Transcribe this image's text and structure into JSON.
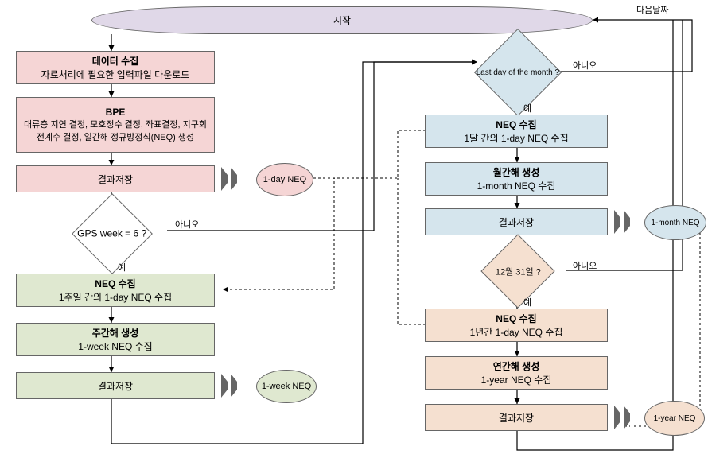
{
  "start": "시작",
  "nextDate": "다음날짜",
  "yes": "예",
  "no": "아니오",
  "left": {
    "dataCollect": {
      "t": "데이터 수집",
      "s": "자료처리에 필요한 입력파일 다운로드"
    },
    "bpe": {
      "t": "BPE",
      "s": "대류층 지연 결정, 모호정수 결정, 좌표결정, 지구회전계수 결정, 일간해 정규방정식(NEQ) 생성"
    },
    "save1": "결과저장",
    "neq1": "1-day NEQ",
    "d1": "GPS week = 6 ?",
    "neqC": {
      "t": "NEQ 수집",
      "s": "1주일 간의 1-day NEQ 수집"
    },
    "wk": {
      "t": "주간해 생성",
      "s": "1-week NEQ 수집"
    },
    "save2": "결과저장",
    "neq2": "1-week NEQ"
  },
  "right": {
    "d2": "Last day of the month ?",
    "neqC": {
      "t": "NEQ 수집",
      "s": "1달 간의 1-day NEQ 수집"
    },
    "mg": {
      "t": "월간해 생성",
      "s": "1-month NEQ 수집"
    },
    "save3": "결과저장",
    "neq3": "1-month NEQ",
    "d3": "12월 31일 ?",
    "neqC2": {
      "t": "NEQ 수집",
      "s": "1년간 1-day NEQ 수집"
    },
    "yg": {
      "t": "연간해 생성",
      "s": "1-year NEQ 수집"
    },
    "save4": "결과저장",
    "neq4": "1-year NEQ"
  }
}
